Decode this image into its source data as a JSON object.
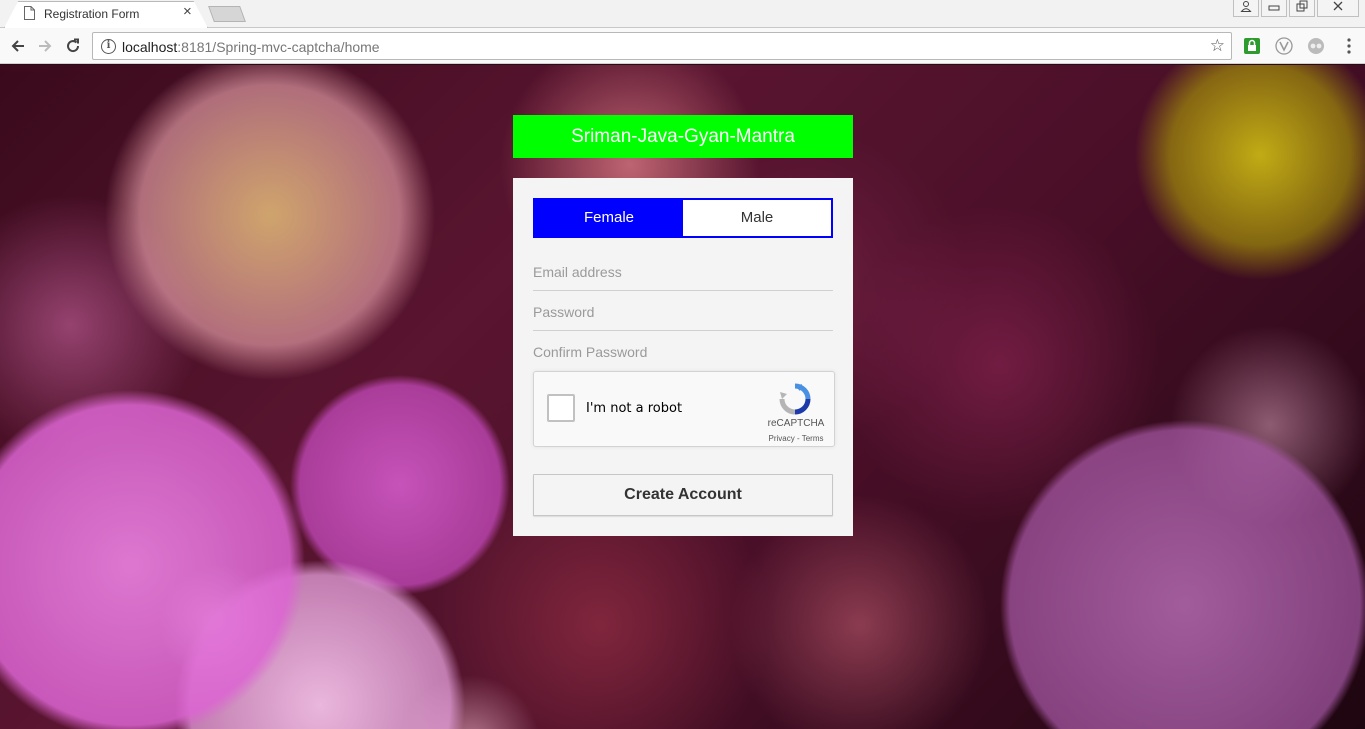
{
  "browser": {
    "tab_title": "Registration Form",
    "tab_close": "×",
    "url_host": "localhost",
    "url_rest": ":8181/Spring-mvc-captcha/home",
    "window_controls": [
      "minimize",
      "restore",
      "close"
    ]
  },
  "brand": {
    "title": "Sriman-Java-Gyan-Mantra",
    "color": "#00ff00"
  },
  "form": {
    "gender": {
      "options": [
        "Female",
        "Male"
      ],
      "selected": "Female",
      "accent": "#0000ff"
    },
    "email_placeholder": "Email address",
    "password_placeholder": "Password",
    "confirm_placeholder": "Confirm Password",
    "captcha": {
      "label": "I'm not a robot",
      "brand": "reCAPTCHA",
      "links": "Privacy - Terms"
    },
    "submit_label": "Create Account"
  }
}
